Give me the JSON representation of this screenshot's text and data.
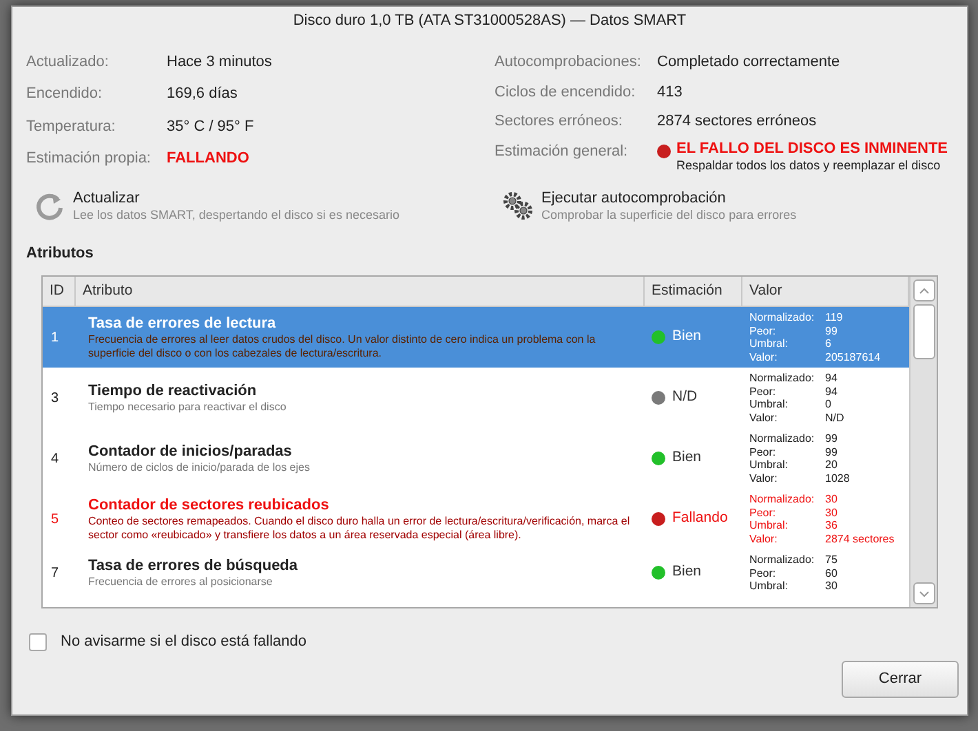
{
  "window": {
    "title": "Disco duro 1,0 TB (ATA ST31000528AS) — Datos SMART"
  },
  "info_left": [
    {
      "label": "Actualizado:",
      "value": "Hace 3 minutos",
      "alert": false
    },
    {
      "label": "Encendido:",
      "value": "169,6 días",
      "alert": false
    },
    {
      "label": "Temperatura:",
      "value": "35° C / 95° F",
      "alert": false
    },
    {
      "label": "Estimación propia:",
      "value": "FALLANDO",
      "alert": true
    }
  ],
  "info_right": [
    {
      "label": "Autocomprobaciones:",
      "value": "Completado correctamente"
    },
    {
      "label": "Ciclos de encendido:",
      "value": "413"
    },
    {
      "label": "Sectores erróneos:",
      "value": "2874 sectores erróneos"
    }
  ],
  "overall": {
    "label": "Estimación general:",
    "color": "#c81e1e",
    "alert": true,
    "headline": "EL FALLO DEL DISCO ES INMINENTE",
    "detail": "Respaldar todos los datos y reemplazar el disco"
  },
  "actions": [
    {
      "kind": "refresh",
      "title": "Actualizar",
      "subtitle": "Lee los datos SMART, despertando el disco si es necesario"
    },
    {
      "kind": "selftest",
      "title": "Ejecutar autocomprobación",
      "subtitle": "Comprobar la superficie del disco para errores"
    }
  ],
  "attributes_heading": "Atributos",
  "table": {
    "columns": [
      "ID",
      "Atributo",
      "Estimación",
      "Valor"
    ],
    "rows": [
      {
        "id": "1",
        "name": "Tasa de errores de lectura",
        "description": "Frecuencia de errores al leer datos crudos del disco. Un valor distinto de cero indica un problema con la superficie del disco o con los cabezales de lectura/escritura.",
        "color": "#22c02a",
        "failing": false,
        "assessment": "Bien",
        "selected": true,
        "values": [
          {
            "label": "Normalizado:",
            "value": "119"
          },
          {
            "label": "Peor:",
            "value": "99"
          },
          {
            "label": "Umbral:",
            "value": "6"
          },
          {
            "label": "Valor:",
            "value": "205187614"
          }
        ]
      },
      {
        "id": "3",
        "name": "Tiempo de reactivación",
        "description": "Tiempo necesario para reactivar el disco",
        "color": "#7a7a7a",
        "failing": false,
        "assessment": "N/D",
        "selected": false,
        "values": [
          {
            "label": "Normalizado:",
            "value": "94"
          },
          {
            "label": "Peor:",
            "value": "94"
          },
          {
            "label": "Umbral:",
            "value": "0"
          },
          {
            "label": "Valor:",
            "value": "N/D"
          }
        ]
      },
      {
        "id": "4",
        "name": "Contador de inicios/paradas",
        "description": "Número de ciclos de inicio/parada de los ejes",
        "color": "#22c02a",
        "failing": false,
        "assessment": "Bien",
        "selected": false,
        "values": [
          {
            "label": "Normalizado:",
            "value": "99"
          },
          {
            "label": "Peor:",
            "value": "99"
          },
          {
            "label": "Umbral:",
            "value": "20"
          },
          {
            "label": "Valor:",
            "value": "1028"
          }
        ]
      },
      {
        "id": "5",
        "name": "Contador de sectores reubicados",
        "description": "Conteo de sectores remapeados. Cuando el disco duro halla un error de lectura/escritura/verificación, marca el sector como «reubicado» y transfiere los datos a un área reservada especial (área libre).",
        "color": "#c81e1e",
        "failing": true,
        "assessment": "Fallando",
        "selected": false,
        "values": [
          {
            "label": "Normalizado:",
            "value": "30"
          },
          {
            "label": "Peor:",
            "value": "30"
          },
          {
            "label": "Umbral:",
            "value": "36"
          },
          {
            "label": "Valor:",
            "value": "2874 sectores"
          }
        ]
      },
      {
        "id": "7",
        "name": "Tasa de errores de búsqueda",
        "description": "Frecuencia de errores al posicionarse",
        "color": "#22c02a",
        "failing": false,
        "assessment": "Bien",
        "selected": false,
        "values": [
          {
            "label": "Normalizado:",
            "value": "75"
          },
          {
            "label": "Peor:",
            "value": "60"
          },
          {
            "label": "Umbral:",
            "value": "30"
          }
        ]
      }
    ]
  },
  "dont_warn": {
    "label": "No avisarme si el disco está fallando",
    "checked": false
  },
  "buttons": [
    "Cerrar"
  ]
}
